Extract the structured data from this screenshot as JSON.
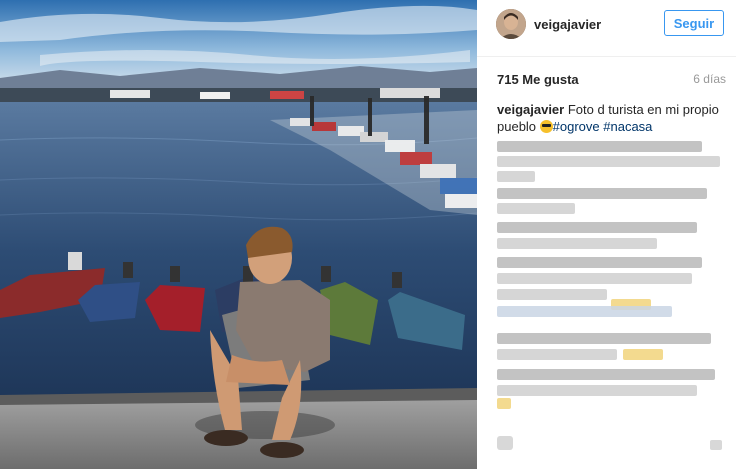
{
  "header": {
    "username": "veigajavier",
    "follow_label": "Seguir"
  },
  "stats": {
    "likes": "715 Me gusta",
    "time": "6 días"
  },
  "caption": {
    "username": "veigajavier",
    "text": " Foto d turista en mi propio pueblo ",
    "hashtags": [
      "#ogrove",
      " #nacasa"
    ]
  },
  "icons": {
    "avatar": "user-avatar",
    "emoji": "sunglasses-emoji",
    "options": "more-options-icon"
  },
  "colors": {
    "accent": "#3897f0",
    "text": "#262626",
    "muted": "#999999",
    "hashtag": "#003569"
  }
}
